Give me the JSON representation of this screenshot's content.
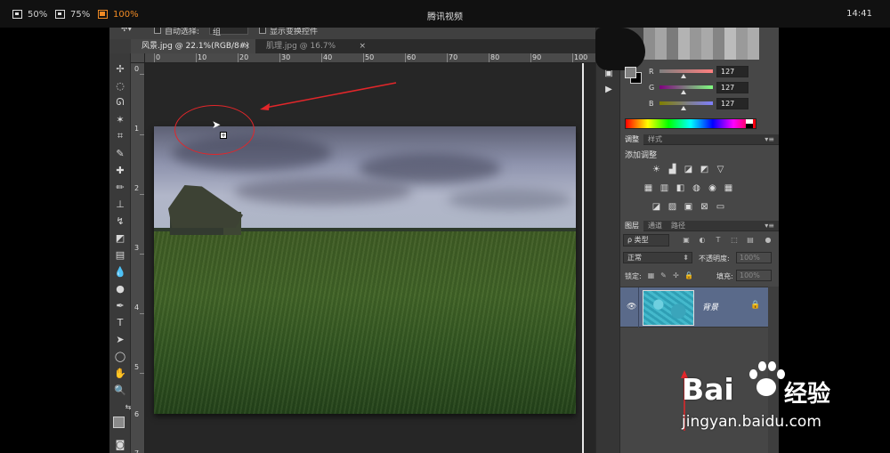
{
  "player": {
    "zoom_options": [
      {
        "label": "50%",
        "active": false
      },
      {
        "label": "75%",
        "active": false
      },
      {
        "label": "100%",
        "active": true
      }
    ],
    "title": "腾讯视频",
    "clock": "14:41",
    "active_color": "#f08a24"
  },
  "options_bar": {
    "auto_select_label": "自动选择:",
    "auto_select_value": "组",
    "show_transform_label": "显示变换控件"
  },
  "doc_tabs": [
    {
      "label": "风景.jpg @ 22.1%(RGB/8#) *",
      "active": true,
      "close": "×"
    },
    {
      "label": "肌理.jpg @ 16.7%(RGB/8#)",
      "active": false,
      "close": "×"
    }
  ],
  "ruler_h": [
    "0",
    "10",
    "20",
    "30",
    "40",
    "50",
    "60",
    "70",
    "80",
    "90",
    "100"
  ],
  "ruler_v": [
    "0",
    "1",
    "2",
    "3",
    "4",
    "5",
    "6",
    "7"
  ],
  "color_panel": {
    "channels": [
      {
        "label": "R",
        "value": "127",
        "gradient": "linear-gradient(90deg,#7f7f7f,#ff7f7f)"
      },
      {
        "label": "G",
        "value": "127",
        "gradient": "linear-gradient(90deg,#7f007f,#7fff7f)"
      },
      {
        "label": "B",
        "value": "127",
        "gradient": "linear-gradient(90deg,#7f7f00,#7f7fff)"
      }
    ]
  },
  "adjustments_panel": {
    "tabs": [
      "调整",
      "样式"
    ],
    "title": "添加调整",
    "menu": "▾≡"
  },
  "layers_panel": {
    "tabs": [
      "图层",
      "通道",
      "路径"
    ],
    "menu": "▾≡",
    "kind_label": "ρ 类型",
    "blend_mode": "正常",
    "opacity_label": "不透明度:",
    "opacity_value": "100%",
    "lock_label": "锁定:",
    "fill_label": "填充:",
    "fill_value": "100%",
    "layer": {
      "name": "背景"
    }
  },
  "watermark": {
    "brand": "Bai",
    "jingyan": "经验",
    "url": "jingyan.baidu.com"
  },
  "annotation_color": "#e2262a"
}
